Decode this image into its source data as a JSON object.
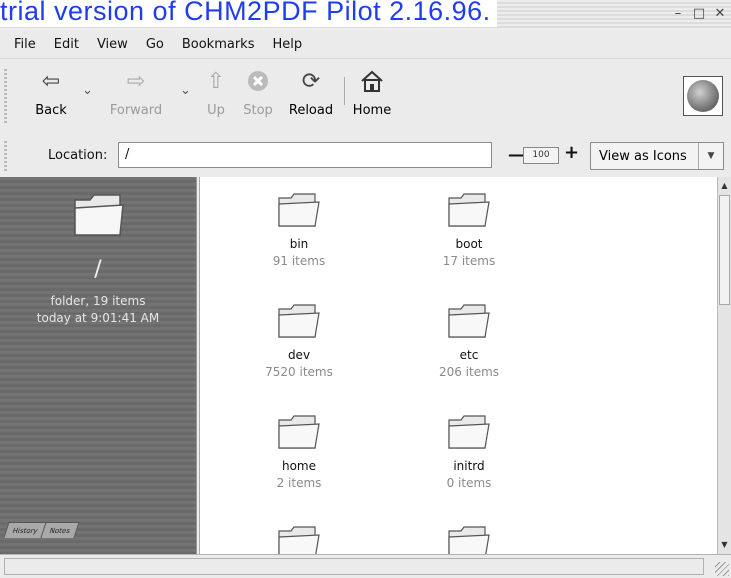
{
  "window": {
    "title": "trial version of CHM2PDF Pilot 2.16.96."
  },
  "menu": [
    "File",
    "Edit",
    "View",
    "Go",
    "Bookmarks",
    "Help"
  ],
  "toolbar": {
    "back": "Back",
    "forward": "Forward",
    "up": "Up",
    "stop": "Stop",
    "reload": "Reload",
    "home": "Home"
  },
  "location": {
    "label": "Location:",
    "value": "/",
    "zoom": "100",
    "view_as": "View as Icons"
  },
  "sidebar": {
    "folder_name": "/",
    "info_line1": "folder, 19 items",
    "info_line2": "today at 9:01:41 AM",
    "tabs": [
      "History",
      "Notes"
    ]
  },
  "files": [
    {
      "name": "bin",
      "count": "91 items"
    },
    {
      "name": "boot",
      "count": "17 items"
    },
    {
      "name": "dev",
      "count": "7520 items"
    },
    {
      "name": "etc",
      "count": "206 items"
    },
    {
      "name": "home",
      "count": "2 items"
    },
    {
      "name": "initrd",
      "count": "0 items"
    }
  ],
  "icons": {
    "back": "left-arrow-icon",
    "forward": "right-arrow-icon",
    "up": "up-arrow-icon",
    "stop": "stop-icon",
    "reload": "reload-icon",
    "home": "home-icon",
    "folder": "folder-icon"
  }
}
